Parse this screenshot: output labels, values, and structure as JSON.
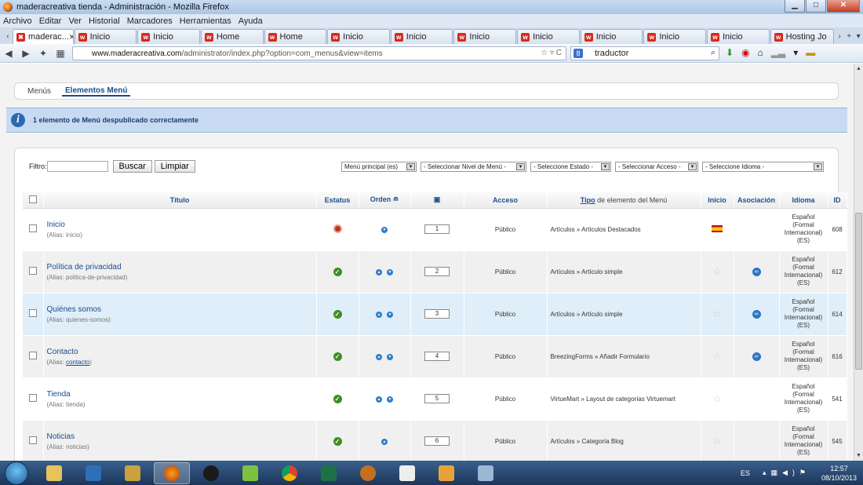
{
  "window": {
    "title": "maderacreativa tienda - Administración - Mozilla Firefox"
  },
  "menubar": [
    "Archivo",
    "Editar",
    "Ver",
    "Historial",
    "Marcadores",
    "Herramientas",
    "Ayuda"
  ],
  "tabs": [
    {
      "label": "maderac...",
      "active": true
    },
    {
      "label": "Inicio"
    },
    {
      "label": "Inicio"
    },
    {
      "label": "Home"
    },
    {
      "label": "Home"
    },
    {
      "label": "Inicio"
    },
    {
      "label": "Inicio"
    },
    {
      "label": "Inicio"
    },
    {
      "label": "Inicio"
    },
    {
      "label": "Inicio"
    },
    {
      "label": "Inicio"
    },
    {
      "label": "Inicio"
    },
    {
      "label": "Hosting Jo"
    }
  ],
  "address": {
    "host": "www.maderacreativa.com",
    "path": "/administrator/index.php?option=com_menus&view=items"
  },
  "search": {
    "value": "traductor"
  },
  "submenu": {
    "menus": "Menús",
    "items": "Elementos Menú"
  },
  "message": "1 elemento de Menú despublicado correctamente",
  "filter": {
    "label": "Filtro:",
    "value": "",
    "search_btn": "Buscar",
    "clear_btn": "Limpiar"
  },
  "selects": [
    "Menú principal (es)",
    "- Seleccionar Nivel de Menú -",
    "- Seleccione Estado -",
    "- Seleccionar Acceso -",
    "- Seleccione Idioma -"
  ],
  "columns": {
    "title": "Título",
    "status": "Estatus",
    "order": "Orden",
    "access": "Acceso",
    "type_link": "Tipo",
    "type_rest": " de elemento del Menú",
    "home": "Inicio",
    "assoc": "Asociación",
    "lang": "Idioma",
    "id": "ID"
  },
  "rows": [
    {
      "title": "Inicio",
      "alias": "inicio",
      "status": "default",
      "order": "1",
      "access": "Público",
      "type": "Artículos » Artículos Destacados",
      "home": "flag",
      "assoc": false,
      "lang": [
        "Español",
        "(Formal",
        "Internacional)",
        "(ES)"
      ],
      "id": "608",
      "arrows": [
        "down"
      ]
    },
    {
      "title": "Política de privacidad",
      "alias": "politica-de-privacidad",
      "status": "published",
      "order": "2",
      "access": "Público",
      "type": "Artículos » Artículo simple",
      "home": "star",
      "assoc": true,
      "lang": [
        "Español",
        "(Formal",
        "Internacional)",
        "(ES)"
      ],
      "id": "612",
      "arrows": [
        "up",
        "down"
      ]
    },
    {
      "title": "Quiénes somos",
      "alias": "quienes-somos",
      "status": "published",
      "order": "3",
      "access": "Público",
      "type": "Artículos » Artículo simple",
      "home": "star",
      "assoc": true,
      "lang": [
        "Español",
        "(Formal",
        "Internacional)",
        "(ES)"
      ],
      "id": "614",
      "arrows": [
        "up",
        "down"
      ]
    },
    {
      "title": "Contacto",
      "alias": "contacto",
      "status": "published",
      "order": "4",
      "access": "Público",
      "type": "BreezingForms » Añadir Formulario",
      "home": "star",
      "assoc": true,
      "lang": [
        "Español",
        "(Formal",
        "Internacional)",
        "(ES)"
      ],
      "id": "616",
      "arrows": [
        "up",
        "down"
      ]
    },
    {
      "title": "Tienda",
      "alias": "tienda",
      "status": "published",
      "order": "5",
      "access": "Público",
      "type": "VirtueMart » Layout de categorías Virtuemart",
      "home": "star",
      "assoc": false,
      "lang": [
        "Español",
        "(Formal",
        "Internacional)",
        "(ES)"
      ],
      "id": "541",
      "arrows": [
        "up",
        "down"
      ]
    },
    {
      "title": "Noticias",
      "alias": "noticias",
      "status": "published",
      "order": "6",
      "access": "Público",
      "type": "Artículos » Categoría Blog",
      "home": "star",
      "assoc": false,
      "lang": [
        "Español",
        "(Formal",
        "Internacional)",
        "(ES)"
      ],
      "id": "545",
      "arrows": [
        "up"
      ]
    }
  ],
  "alias_label": "Alias:",
  "tray": {
    "lang": "ES",
    "time": "12:57",
    "date": "08/10/2013"
  }
}
